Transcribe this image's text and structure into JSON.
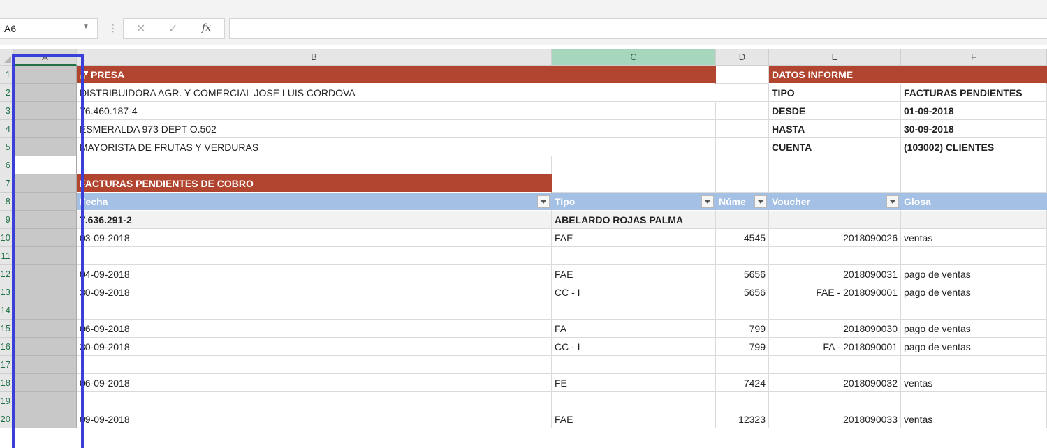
{
  "formula_bar": {
    "name_box": "A6",
    "cancel_icon": "✕",
    "enter_icon": "✓",
    "fx_label": "fx",
    "formula": ""
  },
  "columns": [
    "A",
    "B",
    "C",
    "D",
    "E",
    "F"
  ],
  "rows": [
    "1",
    "2",
    "3",
    "4",
    "5",
    "6",
    "7",
    "8",
    "9",
    "10",
    "11",
    "12",
    "13",
    "14",
    "15",
    "16",
    "17",
    "18",
    "19",
    "20"
  ],
  "company": {
    "header": "PRESA",
    "name": "DISTRIBUIDORA AGR. Y COMERCIAL JOSE LUIS CORDOVA",
    "rut": "76.460.187-4",
    "address": "ESMERALDA 973 DEPT O.502",
    "business": "MAYORISTA DE FRUTAS Y VERDURAS"
  },
  "report": {
    "header": "DATOS INFORME",
    "tipo_label": "TIPO",
    "tipo_value": "FACTURAS PENDIENTES",
    "desde_label": "DESDE",
    "desde_value": "01-09-2018",
    "hasta_label": "HASTA",
    "hasta_value": "30-09-2018",
    "cuenta_label": "CUENTA",
    "cuenta_value": "(103002) CLIENTES"
  },
  "table": {
    "title": "FACTURAS PENDIENTES DE COBRO",
    "headers": {
      "fecha": "Fecha",
      "tipo": "Tipo",
      "numero": "Núme",
      "voucher": "Voucher",
      "glosa": "Glosa"
    },
    "group": {
      "rut": "7.636.291-2",
      "name": "ABELARDO ROJAS PALMA"
    },
    "rows": [
      {
        "fecha": "03-09-2018",
        "tipo": "FAE",
        "numero": "4545",
        "voucher": "2018090026",
        "glosa": "ventas"
      },
      {
        "fecha": "04-09-2018",
        "tipo": "FAE",
        "numero": "5656",
        "voucher": "2018090031",
        "glosa": "pago de ventas"
      },
      {
        "fecha": "30-09-2018",
        "tipo": "CC - I",
        "numero": "5656",
        "voucher": "FAE - 2018090001",
        "glosa": "pago de ventas"
      },
      {
        "fecha": "06-09-2018",
        "tipo": "FA",
        "numero": "799",
        "voucher": "2018090030",
        "glosa": "pago de ventas"
      },
      {
        "fecha": "30-09-2018",
        "tipo": "CC - I",
        "numero": "799",
        "voucher": "FA - 2018090001",
        "glosa": "pago de ventas"
      },
      {
        "fecha": "06-09-2018",
        "tipo": "FE",
        "numero": "7424",
        "voucher": "2018090032",
        "glosa": "ventas"
      },
      {
        "fecha": "09-09-2018",
        "tipo": "FAE",
        "numero": "12323",
        "voucher": "2018090033",
        "glosa": "ventas"
      }
    ]
  }
}
